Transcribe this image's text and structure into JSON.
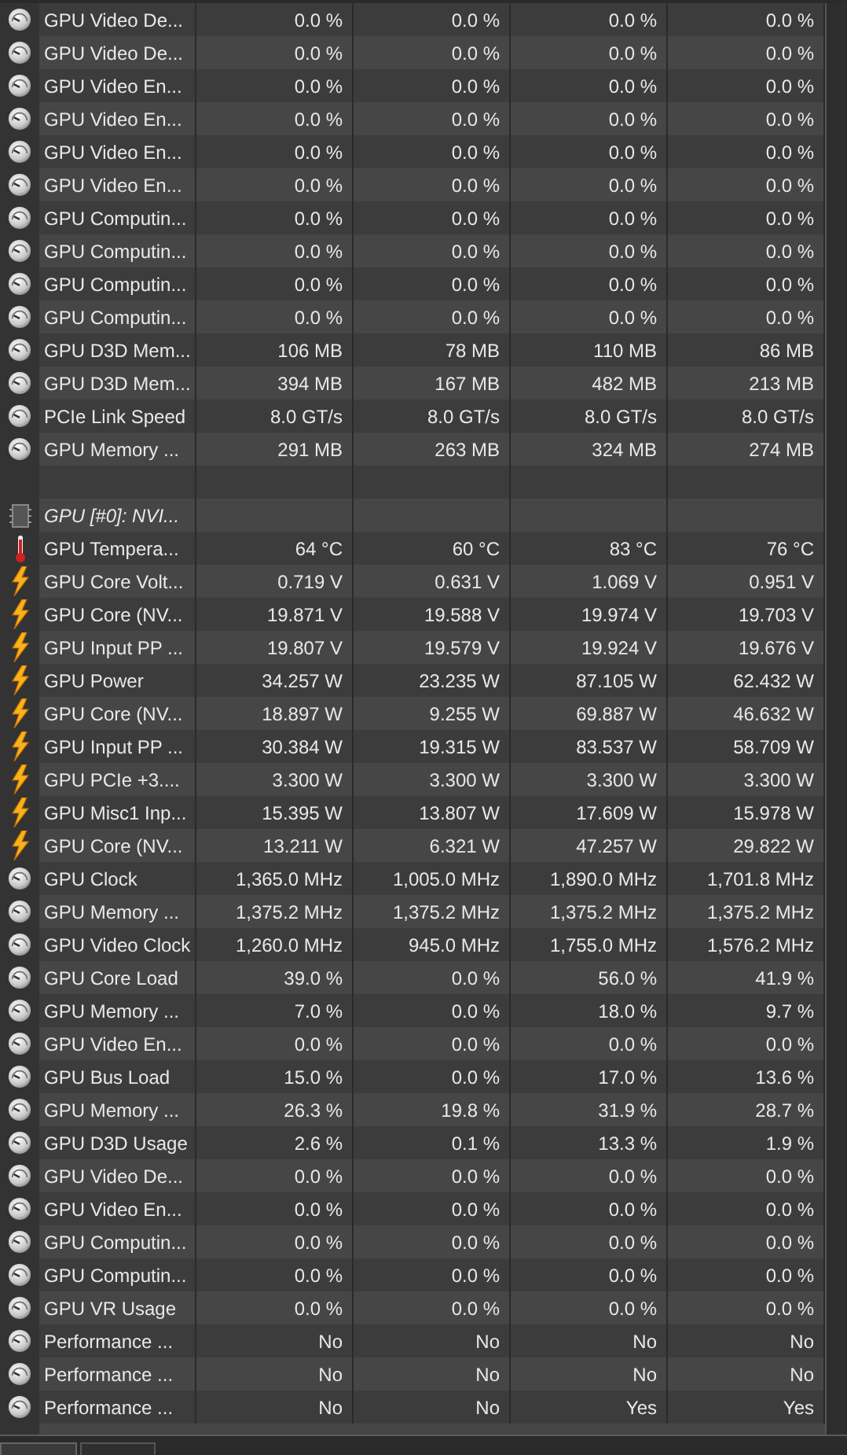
{
  "rows": [
    {
      "kind": "gauge",
      "name": "GPU Video De...",
      "values": [
        "0.0 %",
        "0.0 %",
        "0.0 %",
        "0.0 %"
      ]
    },
    {
      "kind": "gauge",
      "name": "GPU Video De...",
      "values": [
        "0.0 %",
        "0.0 %",
        "0.0 %",
        "0.0 %"
      ]
    },
    {
      "kind": "gauge",
      "name": "GPU Video En...",
      "values": [
        "0.0 %",
        "0.0 %",
        "0.0 %",
        "0.0 %"
      ]
    },
    {
      "kind": "gauge",
      "name": "GPU Video En...",
      "values": [
        "0.0 %",
        "0.0 %",
        "0.0 %",
        "0.0 %"
      ]
    },
    {
      "kind": "gauge",
      "name": "GPU Video En...",
      "values": [
        "0.0 %",
        "0.0 %",
        "0.0 %",
        "0.0 %"
      ]
    },
    {
      "kind": "gauge",
      "name": "GPU Video En...",
      "values": [
        "0.0 %",
        "0.0 %",
        "0.0 %",
        "0.0 %"
      ]
    },
    {
      "kind": "gauge",
      "name": "GPU Computin...",
      "values": [
        "0.0 %",
        "0.0 %",
        "0.0 %",
        "0.0 %"
      ]
    },
    {
      "kind": "gauge",
      "name": "GPU Computin...",
      "values": [
        "0.0 %",
        "0.0 %",
        "0.0 %",
        "0.0 %"
      ]
    },
    {
      "kind": "gauge",
      "name": "GPU Computin...",
      "values": [
        "0.0 %",
        "0.0 %",
        "0.0 %",
        "0.0 %"
      ]
    },
    {
      "kind": "gauge",
      "name": "GPU Computin...",
      "values": [
        "0.0 %",
        "0.0 %",
        "0.0 %",
        "0.0 %"
      ]
    },
    {
      "kind": "gauge",
      "name": "GPU D3D Mem...",
      "values": [
        "106 MB",
        "78 MB",
        "110 MB",
        "86 MB"
      ]
    },
    {
      "kind": "gauge",
      "name": "GPU D3D Mem...",
      "values": [
        "394 MB",
        "167 MB",
        "482 MB",
        "213 MB"
      ]
    },
    {
      "kind": "gauge",
      "name": "PCIe Link Speed",
      "values": [
        "8.0 GT/s",
        "8.0 GT/s",
        "8.0 GT/s",
        "8.0 GT/s"
      ]
    },
    {
      "kind": "gauge",
      "name": "GPU Memory ...",
      "values": [
        "291 MB",
        "263 MB",
        "324 MB",
        "274 MB"
      ]
    },
    {
      "kind": "spacer"
    },
    {
      "kind": "group",
      "name": "GPU [#0]: NVI..."
    },
    {
      "kind": "temperature",
      "name": "GPU Tempera...",
      "values": [
        "64 °C",
        "60 °C",
        "83 °C",
        "76 °C"
      ]
    },
    {
      "kind": "power",
      "name": "GPU Core Volt...",
      "values": [
        "0.719 V",
        "0.631 V",
        "1.069 V",
        "0.951 V"
      ]
    },
    {
      "kind": "power",
      "name": "GPU Core (NV...",
      "values": [
        "19.871 V",
        "19.588 V",
        "19.974 V",
        "19.703 V"
      ]
    },
    {
      "kind": "power",
      "name": "GPU Input PP ...",
      "values": [
        "19.807 V",
        "19.579 V",
        "19.924 V",
        "19.676 V"
      ]
    },
    {
      "kind": "power",
      "name": "GPU Power",
      "values": [
        "34.257 W",
        "23.235 W",
        "87.105 W",
        "62.432 W"
      ]
    },
    {
      "kind": "power",
      "name": "GPU Core (NV...",
      "values": [
        "18.897 W",
        "9.255 W",
        "69.887 W",
        "46.632 W"
      ]
    },
    {
      "kind": "power",
      "name": "GPU Input PP ...",
      "values": [
        "30.384 W",
        "19.315 W",
        "83.537 W",
        "58.709 W"
      ]
    },
    {
      "kind": "power",
      "name": "GPU PCIe +3....",
      "values": [
        "3.300 W",
        "3.300 W",
        "3.300 W",
        "3.300 W"
      ]
    },
    {
      "kind": "power",
      "name": "GPU Misc1 Inp...",
      "values": [
        "15.395 W",
        "13.807 W",
        "17.609 W",
        "15.978 W"
      ]
    },
    {
      "kind": "power",
      "name": "GPU Core (NV...",
      "values": [
        "13.211 W",
        "6.321 W",
        "47.257 W",
        "29.822 W"
      ]
    },
    {
      "kind": "gauge",
      "name": "GPU Clock",
      "values": [
        "1,365.0 MHz",
        "1,005.0 MHz",
        "1,890.0 MHz",
        "1,701.8 MHz"
      ]
    },
    {
      "kind": "gauge",
      "name": "GPU Memory ...",
      "values": [
        "1,375.2 MHz",
        "1,375.2 MHz",
        "1,375.2 MHz",
        "1,375.2 MHz"
      ]
    },
    {
      "kind": "gauge",
      "name": "GPU Video Clock",
      "values": [
        "1,260.0 MHz",
        "945.0 MHz",
        "1,755.0 MHz",
        "1,576.2 MHz"
      ]
    },
    {
      "kind": "gauge",
      "name": "GPU Core Load",
      "values": [
        "39.0 %",
        "0.0 %",
        "56.0 %",
        "41.9 %"
      ]
    },
    {
      "kind": "gauge",
      "name": "GPU Memory ...",
      "values": [
        "7.0 %",
        "0.0 %",
        "18.0 %",
        "9.7 %"
      ]
    },
    {
      "kind": "gauge",
      "name": "GPU Video En...",
      "values": [
        "0.0 %",
        "0.0 %",
        "0.0 %",
        "0.0 %"
      ]
    },
    {
      "kind": "gauge",
      "name": "GPU Bus Load",
      "values": [
        "15.0 %",
        "0.0 %",
        "17.0 %",
        "13.6 %"
      ]
    },
    {
      "kind": "gauge",
      "name": "GPU Memory ...",
      "values": [
        "26.3 %",
        "19.8 %",
        "31.9 %",
        "28.7 %"
      ]
    },
    {
      "kind": "gauge",
      "name": "GPU D3D Usage",
      "values": [
        "2.6 %",
        "0.1 %",
        "13.3 %",
        "1.9 %"
      ]
    },
    {
      "kind": "gauge",
      "name": "GPU Video De...",
      "values": [
        "0.0 %",
        "0.0 %",
        "0.0 %",
        "0.0 %"
      ]
    },
    {
      "kind": "gauge",
      "name": "GPU Video En...",
      "values": [
        "0.0 %",
        "0.0 %",
        "0.0 %",
        "0.0 %"
      ]
    },
    {
      "kind": "gauge",
      "name": "GPU Computin...",
      "values": [
        "0.0 %",
        "0.0 %",
        "0.0 %",
        "0.0 %"
      ]
    },
    {
      "kind": "gauge",
      "name": "GPU Computin...",
      "values": [
        "0.0 %",
        "0.0 %",
        "0.0 %",
        "0.0 %"
      ]
    },
    {
      "kind": "gauge",
      "name": "GPU VR Usage",
      "values": [
        "0.0 %",
        "0.0 %",
        "0.0 %",
        "0.0 %"
      ]
    },
    {
      "kind": "gauge",
      "name": "Performance ...",
      "values": [
        "No",
        "No",
        "No",
        "No"
      ]
    },
    {
      "kind": "gauge",
      "name": "Performance ...",
      "values": [
        "No",
        "No",
        "No",
        "No"
      ]
    },
    {
      "kind": "gauge",
      "name": "Performance ...",
      "values": [
        "No",
        "No",
        "Yes",
        "Yes"
      ]
    }
  ]
}
